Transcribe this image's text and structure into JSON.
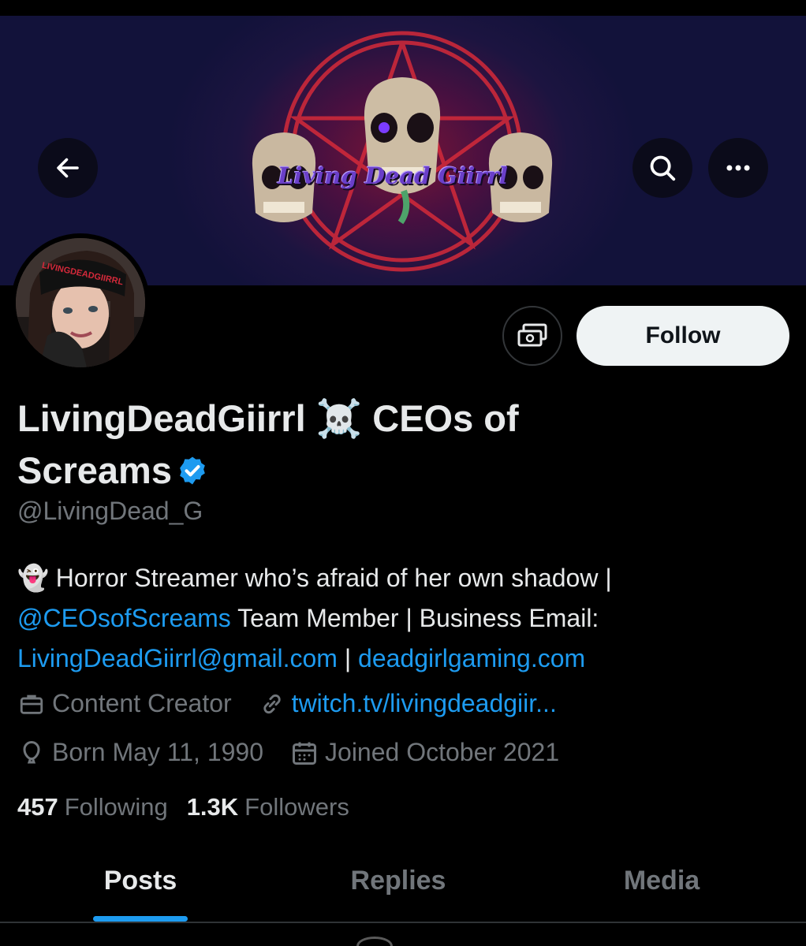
{
  "banner": {
    "logo_text": "Living Dead Giirrl"
  },
  "avatar": {
    "beanie_text": "LIVINGDEADGIIRRL"
  },
  "profile": {
    "display_name": "LivingDeadGiirrl ☠️ CEOs of Screams",
    "handle": "@LivingDead_G",
    "verified": true,
    "follow_label": "Follow"
  },
  "bio": {
    "emoji": "👻",
    "text1": " Horror Streamer who’s afraid of her own shadow | ",
    "mention": "@CEOsofScreams",
    "text2": " Team Member | Business Email: ",
    "email": "LivingDeadGiirrl@gmail.com",
    "sep": " | ",
    "website": "deadgirlgaming.com"
  },
  "meta": {
    "category": "Content Creator",
    "link": "twitch.tv/livingdeadgiir...",
    "born": "Born May 11, 1990",
    "joined": "Joined October 2021"
  },
  "stats": {
    "following_count": "457",
    "following_label": "Following",
    "followers_count": "1.3K",
    "followers_label": "Followers"
  },
  "tabs": [
    {
      "label": "Posts",
      "active": true
    },
    {
      "label": "Replies",
      "active": false
    },
    {
      "label": "Media",
      "active": false
    }
  ],
  "colors": {
    "accent": "#1d9bf0",
    "background": "#000000",
    "text_primary": "#e7e9ea",
    "text_secondary": "#71767b"
  }
}
